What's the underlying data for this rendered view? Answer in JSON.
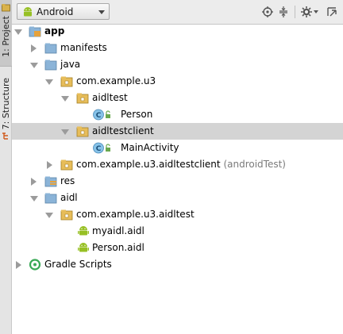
{
  "left_strip": {
    "project_tab": "1: Project",
    "structure_tab": "7: Structure"
  },
  "toolbar": {
    "view_select": "Android"
  },
  "tree": {
    "app": "app",
    "manifests": "manifests",
    "java": "java",
    "pkg_u3": "com.example.u3",
    "aidltest": "aidltest",
    "person": "Person",
    "aidltestclient": "aidltestclient",
    "main_activity": "MainActivity",
    "pkg_android_test": "com.example.u3.aidltestclient",
    "android_test_suffix": "(androidTest)",
    "res": "res",
    "aidl": "aidl",
    "pkg_aidltest": "com.example.u3.aidltest",
    "myaidl": "myaidl.aidl",
    "person_aidl": "Person.aidl",
    "gradle": "Gradle Scripts"
  },
  "colors": {
    "folder": "#8bb4d8",
    "folder_yellow": "#e7bd5a",
    "android_green": "#97c024",
    "class_circle": "#86c2e8",
    "selected_row": "#d4d4d4"
  }
}
